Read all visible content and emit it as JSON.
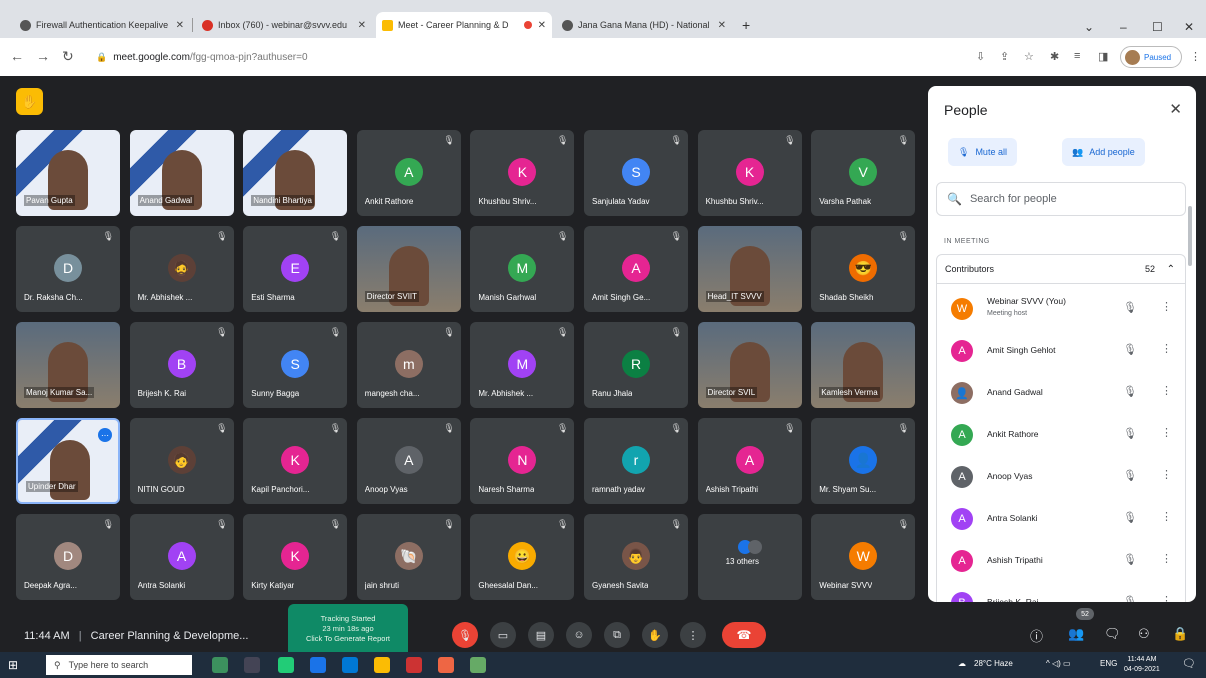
{
  "browser": {
    "tabs": [
      {
        "title": "Firewall Authentication Keepalive",
        "fav_color": "#555555"
      },
      {
        "title": "Inbox (760) - webinar@svvv.edu",
        "fav_color": "#d93025"
      },
      {
        "title": "Meet - Career Planning & D",
        "fav_color": "#fbbc04",
        "active": true
      },
      {
        "title": "Jana Gana Mana (HD) - National",
        "fav_color": "#555555"
      }
    ],
    "new_tab": "+",
    "url_host": "meet.google.com",
    "url_path": "/fgg-qmoa-pjn?authuser=0",
    "profile_label": "Paused"
  },
  "meet": {
    "tiles": [
      {
        "name": "Pavan Gupta",
        "type": "video",
        "style": "blue"
      },
      {
        "name": "Anand Gadwal",
        "type": "video",
        "style": "blue"
      },
      {
        "name": "Nandini Bhartiya",
        "type": "video",
        "style": "blue"
      },
      {
        "name": "Ankit Rathore",
        "initial": "A",
        "color": "#34a853"
      },
      {
        "name": "Khushbu Shriv...",
        "initial": "K",
        "color": "#e52592"
      },
      {
        "name": "Sanjulata Yadav",
        "initial": "S",
        "color": "#4285f4"
      },
      {
        "name": "Khushbu Shriv...",
        "initial": "K",
        "color": "#e52592"
      },
      {
        "name": "Varsha Pathak",
        "initial": "V",
        "color": "#34a853"
      },
      {
        "name": "Dr. Raksha Ch...",
        "initial": "D",
        "color": "#78909c"
      },
      {
        "name": "Mr. Abhishek ...",
        "initial": "🧔",
        "color": "#5d4037"
      },
      {
        "name": "Esti Sharma",
        "initial": "E",
        "color": "#a142f4"
      },
      {
        "name": "Director SVIIT",
        "type": "video",
        "style": "room"
      },
      {
        "name": "Manish Garhwal",
        "initial": "M",
        "color": "#34a853"
      },
      {
        "name": "Amit Singh Ge...",
        "initial": "A",
        "color": "#e52592"
      },
      {
        "name": "Head_IT SVVV",
        "type": "video",
        "style": "room"
      },
      {
        "name": "Shadab Sheikh",
        "initial": "😎",
        "color": "#ef6c00"
      },
      {
        "name": "Manoj Kumar Sa...",
        "type": "video",
        "style": "room"
      },
      {
        "name": "Brijesh K. Rai",
        "initial": "B",
        "color": "#a142f4"
      },
      {
        "name": "Sunny Bagga",
        "initial": "S",
        "color": "#4285f4"
      },
      {
        "name": "mangesh cha...",
        "initial": "m",
        "color": "#8d6e63"
      },
      {
        "name": "Mr. Abhishek ...",
        "initial": "M",
        "color": "#a142f4"
      },
      {
        "name": "Ranu Jhala",
        "initial": "R",
        "color": "#0b8043"
      },
      {
        "name": "Director SVIL",
        "type": "video",
        "style": "room"
      },
      {
        "name": "Kamlesh Verma",
        "type": "video",
        "style": "room"
      },
      {
        "name": "Upinder Dhar",
        "type": "video",
        "style": "blue",
        "selected": true
      },
      {
        "name": "NITIN GOUD",
        "initial": "🧑",
        "color": "#5d4037"
      },
      {
        "name": "Kapil Panchori...",
        "initial": "K",
        "color": "#e52592"
      },
      {
        "name": "Anoop Vyas",
        "initial": "A",
        "color": "#5f6368"
      },
      {
        "name": "Naresh Sharma",
        "initial": "N",
        "color": "#e52592"
      },
      {
        "name": "ramnath yadav",
        "initial": "r",
        "color": "#12a4af"
      },
      {
        "name": "Ashish Tripathi",
        "initial": "A",
        "color": "#e52592"
      },
      {
        "name": "Mr. Shyam Su...",
        "initial": "👤",
        "color": "#1a73e8"
      },
      {
        "name": "Deepak Agra...",
        "initial": "D",
        "color": "#a1887f"
      },
      {
        "name": "Antra Solanki",
        "initial": "A",
        "color": "#a142f4"
      },
      {
        "name": "Kirty Katiyar",
        "initial": "K",
        "color": "#e52592"
      },
      {
        "name": "jain shruti",
        "initial": "🐚",
        "color": "#8d6e63"
      },
      {
        "name": "Gheesalal Dan...",
        "initial": "😀",
        "color": "#f9ab00"
      },
      {
        "name": "Gyanesh Savita",
        "initial": "👨",
        "color": "#795548"
      },
      {
        "name": "13 others",
        "type": "others"
      },
      {
        "name": "Webinar SVVV",
        "initial": "W",
        "color": "#f57c00"
      }
    ],
    "people_panel": {
      "title": "People",
      "mute_all": "Mute all",
      "add_people": "Add people",
      "search_placeholder": "Search for people",
      "in_meeting": "IN MEETING",
      "group": "Contributors",
      "count": "52",
      "people": [
        {
          "name": "Webinar SVVV (You)",
          "sub": "Meeting host",
          "initial": "W",
          "color": "#f57c00"
        },
        {
          "name": "Amit Singh Gehlot",
          "initial": "A",
          "color": "#e52592"
        },
        {
          "name": "Anand Gadwal",
          "initial": "👤",
          "color": "#8d6e63"
        },
        {
          "name": "Ankit Rathore",
          "initial": "A",
          "color": "#34a853"
        },
        {
          "name": "Anoop Vyas",
          "initial": "A",
          "color": "#5f6368"
        },
        {
          "name": "Antra Solanki",
          "initial": "A",
          "color": "#a142f4"
        },
        {
          "name": "Ashish Tripathi",
          "initial": "A",
          "color": "#e52592"
        },
        {
          "name": "Brijesh K. Rai",
          "initial": "B",
          "color": "#a142f4"
        }
      ]
    },
    "bottom": {
      "time": "11:44 AM",
      "separator": "|",
      "meeting_title": "Career Planning & Developme...",
      "tracking_line1": "Tracking Started",
      "tracking_line2": "23 min 18s ago",
      "tracking_line3": "Click To Generate Report",
      "people_count": "52"
    }
  },
  "taskbar": {
    "search_placeholder": "Type here to search",
    "weather": "28°C Haze",
    "lang": "ENG",
    "clock_time": "11:44 AM",
    "clock_date": "04-09-2021"
  }
}
